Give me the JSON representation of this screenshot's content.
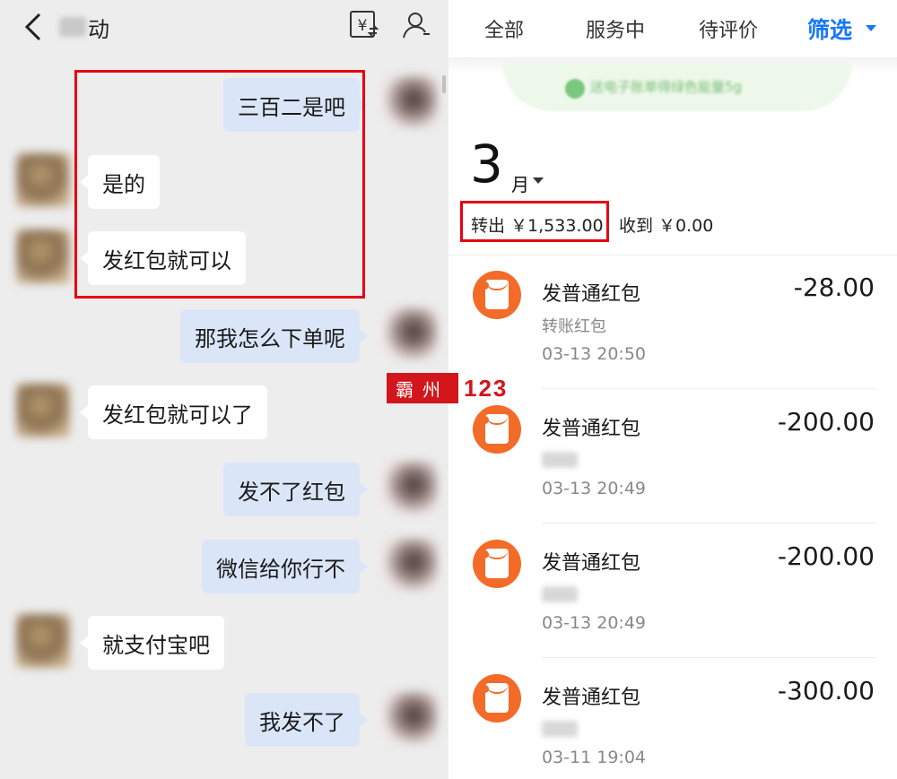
{
  "chat": {
    "title": "动",
    "messages": [
      {
        "side": "mine",
        "text": "三百二是吧"
      },
      {
        "side": "theirs",
        "text": "是的"
      },
      {
        "side": "theirs",
        "text": "发红包就可以"
      },
      {
        "side": "mine",
        "text": "那我怎么下单呢"
      },
      {
        "side": "theirs",
        "text": "发红包就可以了"
      },
      {
        "side": "mine",
        "text": "发不了红包"
      },
      {
        "side": "mine",
        "text": "微信给你行不"
      },
      {
        "side": "theirs",
        "text": "就支付宝吧"
      },
      {
        "side": "mine",
        "text": "我发不了"
      }
    ]
  },
  "watermark": {
    "chars": "霸州",
    "number": "123"
  },
  "bills": {
    "tabs": [
      "全部",
      "服务中",
      "待评价"
    ],
    "filter_label": "筛选",
    "banner_text": "送电子账单得绿色能量5g",
    "month": {
      "number": "3",
      "unit": "月"
    },
    "summary": {
      "out": "转出 ￥1,533.00",
      "in": "收到 ￥0.00"
    },
    "rows": [
      {
        "title": "发普通红包",
        "subtitle": "转账红包",
        "time": "03-13  20:50",
        "amount": "-28.00"
      },
      {
        "title": "发普通红包",
        "subtitle": "",
        "time": "03-13  20:49",
        "amount": "-200.00"
      },
      {
        "title": "发普通红包",
        "subtitle": "",
        "time": "03-13  20:49",
        "amount": "-200.00"
      },
      {
        "title": "发普通红包",
        "subtitle": "",
        "time": "03-11  19:04",
        "amount": "-300.00"
      }
    ]
  },
  "colors": {
    "highlight": "#e60012",
    "accent": "#1677ff",
    "redpacket": "#f26b28",
    "my_bubble": "#dae6f8"
  }
}
